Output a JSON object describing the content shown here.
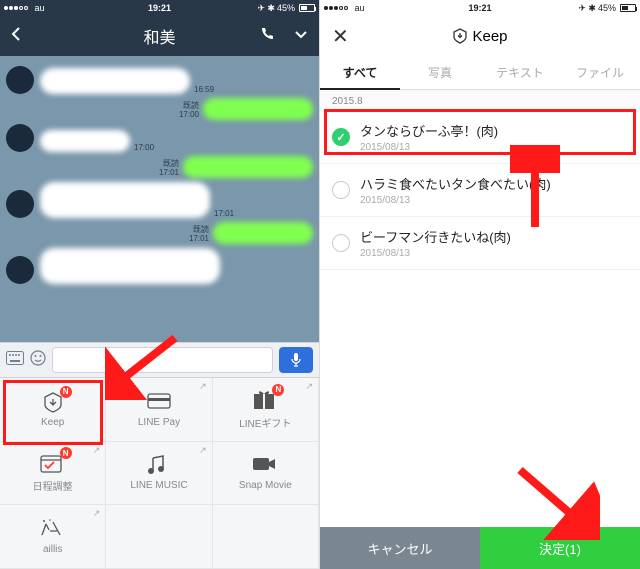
{
  "status": {
    "carrier": "au",
    "time": "19:21",
    "battery": "45%"
  },
  "left": {
    "title": "和美",
    "read_label": "既読",
    "ts": {
      "t1": "16:59",
      "t2": "17:00",
      "t3": "17:00",
      "t4": "17:01",
      "t5": "17:01",
      "t6": "17:01"
    },
    "grid": {
      "keep": "Keep",
      "linepay": "LINE Pay",
      "gift": "LINEギフト",
      "schedule": "日程調整",
      "music": "LINE MUSIC",
      "snap": "Snap Movie",
      "aillis": "aillis",
      "badge": "N"
    }
  },
  "right": {
    "title": "Keep",
    "tabs": {
      "all": "すべて",
      "photo": "写真",
      "text": "テキスト",
      "file": "ファイル"
    },
    "section": "2015.8",
    "items": [
      {
        "title": "タンならびーふ亭！(肉)",
        "date": "2015/08/13",
        "selected": true
      },
      {
        "title": "ハラミ食べたいタン食べたい(肉)",
        "date": "2015/08/13",
        "selected": false
      },
      {
        "title": "ビーフマン行きたいね(肉)",
        "date": "2015/08/13",
        "selected": false
      }
    ],
    "cancel": "キャンセル",
    "ok": "決定(1)"
  }
}
